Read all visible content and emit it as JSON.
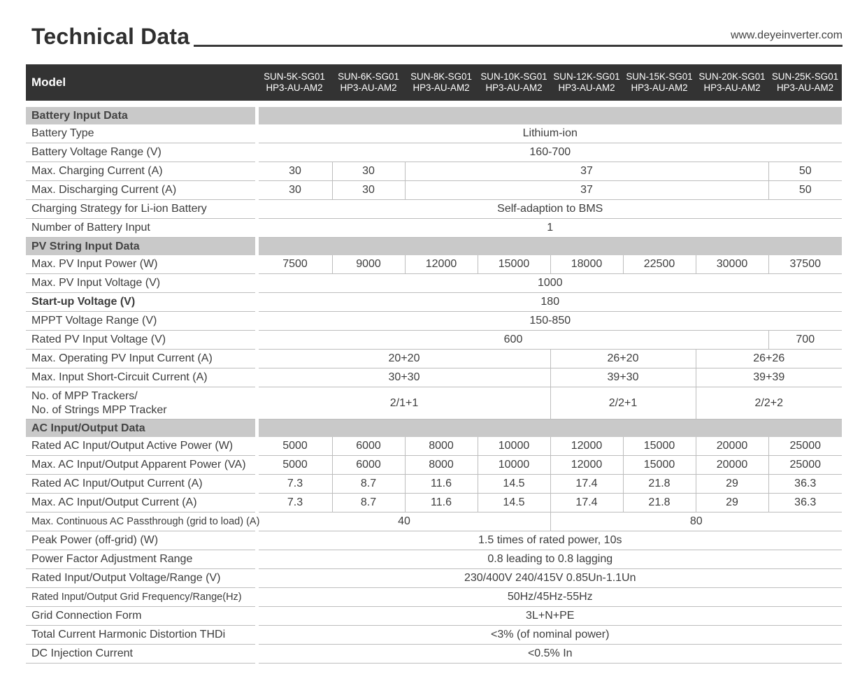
{
  "header": {
    "title": "Technical Data",
    "website": "www.deyeinverter.com"
  },
  "table": {
    "model_label": "Model",
    "models": [
      {
        "line1": "SUN-5K-SG01",
        "line2": "HP3-AU-AM2"
      },
      {
        "line1": "SUN-6K-SG01",
        "line2": "HP3-AU-AM2"
      },
      {
        "line1": "SUN-8K-SG01",
        "line2": "HP3-AU-AM2"
      },
      {
        "line1": "SUN-10K-SG01",
        "line2": "HP3-AU-AM2"
      },
      {
        "line1": "SUN-12K-SG01",
        "line2": "HP3-AU-AM2"
      },
      {
        "line1": "SUN-15K-SG01",
        "line2": "HP3-AU-AM2"
      },
      {
        "line1": "SUN-20K-SG01",
        "line2": "HP3-AU-AM2"
      },
      {
        "line1": "SUN-25K-SG01",
        "line2": "HP3-AU-AM2"
      }
    ],
    "rows": [
      {
        "section": "Battery Input Data"
      },
      {
        "label": "Battery Type",
        "cells": [
          [
            "Lithium-ion",
            8
          ]
        ]
      },
      {
        "label": "Battery Voltage Range (V)",
        "cells": [
          [
            "160-700",
            8
          ]
        ]
      },
      {
        "label": "Max. Charging Current (A)",
        "cells": [
          [
            "30",
            1
          ],
          [
            "30",
            1
          ],
          [
            "37",
            5
          ],
          [
            "50",
            1
          ]
        ]
      },
      {
        "label": "Max. Discharging Current (A)",
        "cells": [
          [
            "30",
            1
          ],
          [
            "30",
            1
          ],
          [
            "37",
            5
          ],
          [
            "50",
            1
          ]
        ]
      },
      {
        "label": "Charging Strategy for Li-ion Battery",
        "cells": [
          [
            "Self-adaption to BMS",
            8
          ]
        ]
      },
      {
        "label": "Number of Battery Input",
        "cells": [
          [
            "1",
            8
          ]
        ]
      },
      {
        "section": "PV String Input Data"
      },
      {
        "label": "Max. PV Input Power (W)",
        "cells": [
          [
            "7500",
            1
          ],
          [
            "9000",
            1
          ],
          [
            "12000",
            1
          ],
          [
            "15000",
            1
          ],
          [
            "18000",
            1
          ],
          [
            "22500",
            1
          ],
          [
            "30000",
            1
          ],
          [
            "37500",
            1
          ]
        ]
      },
      {
        "label": "Max. PV Input Voltage (V)",
        "cells": [
          [
            "1000",
            8
          ]
        ]
      },
      {
        "label": "Start-up Voltage (V)",
        "bold": true,
        "cells": [
          [
            "180",
            8
          ]
        ]
      },
      {
        "label": "MPPT  Voltage Range (V)",
        "cells": [
          [
            "150-850",
            8
          ]
        ]
      },
      {
        "label": "Rated PV Input Voltage (V)",
        "cells": [
          [
            "600",
            7
          ],
          [
            "700",
            1
          ]
        ]
      },
      {
        "label": "Max. Operating PV Input Current (A)",
        "cells": [
          [
            "20+20",
            4
          ],
          [
            "26+20",
            2
          ],
          [
            "26+26",
            2
          ]
        ]
      },
      {
        "label": "Max. Input Short-Circuit Current (A)",
        "cells": [
          [
            "30+30",
            4
          ],
          [
            "39+30",
            2
          ],
          [
            "39+39",
            2
          ]
        ]
      },
      {
        "label": "No. of MPP Trackers/",
        "label2": "No. of Strings  MPP Tracker",
        "tall": true,
        "cells": [
          [
            "2/1+1",
            4
          ],
          [
            "2/2+1",
            2
          ],
          [
            "2/2+2",
            2
          ]
        ]
      },
      {
        "section": "AC Input/Output Data"
      },
      {
        "label": "Rated AC Input/Output Active Power (W)",
        "cells": [
          [
            "5000",
            1
          ],
          [
            "6000",
            1
          ],
          [
            "8000",
            1
          ],
          [
            "10000",
            1
          ],
          [
            "12000",
            1
          ],
          [
            "15000",
            1
          ],
          [
            "20000",
            1
          ],
          [
            "25000",
            1
          ]
        ]
      },
      {
        "label": "Max. AC Input/Output Apparent Power (VA)",
        "cells": [
          [
            "5000",
            1
          ],
          [
            "6000",
            1
          ],
          [
            "8000",
            1
          ],
          [
            "10000",
            1
          ],
          [
            "12000",
            1
          ],
          [
            "15000",
            1
          ],
          [
            "20000",
            1
          ],
          [
            "25000",
            1
          ]
        ]
      },
      {
        "label": "Rated AC Input/Output Current (A)",
        "cells": [
          [
            "7.3",
            1
          ],
          [
            "8.7",
            1
          ],
          [
            "11.6",
            1
          ],
          [
            "14.5",
            1
          ],
          [
            "17.4",
            1
          ],
          [
            "21.8",
            1
          ],
          [
            "29",
            1
          ],
          [
            "36.3",
            1
          ]
        ]
      },
      {
        "label": "Max. AC Input/Output Current (A)",
        "cells": [
          [
            "7.3",
            1
          ],
          [
            "8.7",
            1
          ],
          [
            "11.6",
            1
          ],
          [
            "14.5",
            1
          ],
          [
            "17.4",
            1
          ],
          [
            "21.8",
            1
          ],
          [
            "29",
            1
          ],
          [
            "36.3",
            1
          ]
        ]
      },
      {
        "label": "Max. Continuous AC Passthrough (grid to load) (A)",
        "small": true,
        "cells": [
          [
            "40",
            4
          ],
          [
            "80",
            4
          ]
        ]
      },
      {
        "label": "Peak Power (off-grid) (W)",
        "cells": [
          [
            "1.5 times of rated power, 10s",
            8
          ]
        ]
      },
      {
        "label": "Power Factor Adjustment Range",
        "cells": [
          [
            "0.8 leading to 0.8 lagging",
            8
          ]
        ]
      },
      {
        "label": "Rated Input/Output Voltage/Range (V)",
        "cells": [
          [
            "230/400V  240/415V 0.85Un-1.1Un",
            8
          ]
        ]
      },
      {
        "label": "Rated Input/Output Grid Frequency/Range(Hz)",
        "small": true,
        "cells": [
          [
            "50Hz/45Hz-55Hz",
            8
          ]
        ]
      },
      {
        "label": "Grid Connection Form",
        "cells": [
          [
            "3L+N+PE",
            8
          ]
        ]
      },
      {
        "label": "Total Current Harmonic Distortion THDi",
        "cells": [
          [
            "<3% (of nominal power)",
            8
          ]
        ]
      },
      {
        "label": "DC Injection Current",
        "cells": [
          [
            "<0.5% In",
            8
          ]
        ]
      }
    ]
  }
}
